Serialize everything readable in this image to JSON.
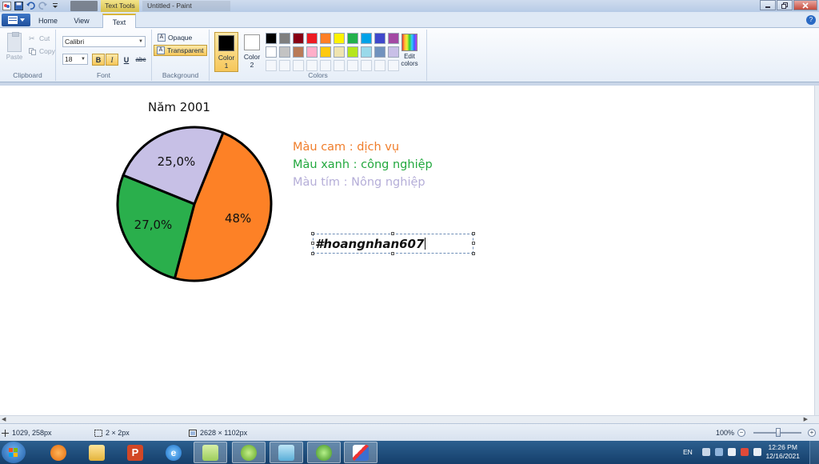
{
  "window": {
    "title": "Untitled - Paint",
    "context_tab": "Text Tools"
  },
  "tabs": [
    {
      "label": "Home"
    },
    {
      "label": "View"
    },
    {
      "label": "Text"
    }
  ],
  "clipboard": {
    "paste": "Paste",
    "cut": "Cut",
    "copy": "Copy",
    "label": "Clipboard"
  },
  "font": {
    "family": "Calibri",
    "size": "18",
    "bold": "B",
    "italic": "I",
    "underline": "U",
    "strike": "abc",
    "label": "Font"
  },
  "background": {
    "opaque": "Opaque",
    "transparent": "Transparent",
    "label": "Background"
  },
  "colors": {
    "color1_label": "Color\n1",
    "color1_line1": "Color",
    "color1_line2": "1",
    "color2_line1": "Color",
    "color2_line2": "2",
    "color1_value": "#000000",
    "color2_value": "#ffffff",
    "edit_line1": "Edit",
    "edit_line2": "colors",
    "label": "Colors",
    "palette_row1": [
      "#000000",
      "#7f7f7f",
      "#880015",
      "#ed1c24",
      "#ff7f27",
      "#fff200",
      "#22b14c",
      "#00a2e8",
      "#3f48cc",
      "#a349a4"
    ],
    "palette_row2": [
      "#ffffff",
      "#c3c3c3",
      "#b97a57",
      "#ffaec9",
      "#ffc90e",
      "#efe4b0",
      "#b5e61d",
      "#99d9ea",
      "#7092be",
      "#c8bfe7"
    ]
  },
  "canvas": {
    "chart_title": "Năm 2001",
    "legend": [
      {
        "text": "Màu cam : dịch vụ",
        "color": "#f07d2a"
      },
      {
        "text": "Màu xanh : công nghiệp",
        "color": "#22a83e"
      },
      {
        "text": "Màu tím : Nông nghiệp",
        "color": "#b5aed8"
      }
    ],
    "textbox_text": "#hoangnhan607"
  },
  "chart_data": {
    "type": "pie",
    "title": "Năm 2001",
    "labels": [
      "48%",
      "27,0%",
      "25,0%"
    ],
    "values": [
      48,
      27,
      25
    ],
    "colors": [
      "#fd8126",
      "#2aaf4c",
      "#c7c0e6"
    ],
    "legend_placement": "right"
  },
  "status": {
    "cursor_pos": "1029, 258px",
    "selection_size": "2 × 2px",
    "image_size": "2628 × 1102px",
    "zoom": "100%"
  },
  "taskbar": {
    "lang": "EN",
    "time": "12:26 PM",
    "date": "12/16/2021"
  }
}
